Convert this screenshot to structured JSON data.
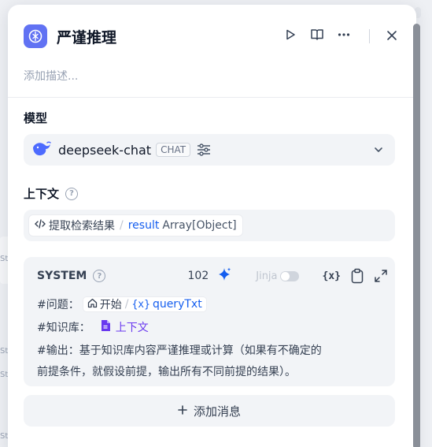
{
  "node": {
    "title": "严谨推理",
    "description_placeholder": "添加描述..."
  },
  "model": {
    "label": "模型",
    "name": "deepseek-chat",
    "mode_badge": "CHAT"
  },
  "context": {
    "label": "上下文",
    "chip": {
      "node_name": "提取检索结果",
      "variable": "result",
      "type": "Array[Object]"
    }
  },
  "system_prompt": {
    "role": "SYSTEM",
    "token_count": "102",
    "jinja_label": "Jinja",
    "jinja_enabled": false,
    "lines": {
      "question_prefix": "#问题：",
      "question_node": "开始",
      "question_var": "queryTxt",
      "kb_prefix": "#知识库：",
      "kb_ref": "上下文",
      "output_line1": "#输出：基于知识库内容严谨推理或计算（如果有不确定的",
      "output_line2": "前提条件，就假设前提，输出所有不同前提的结果）。"
    }
  },
  "add_message_label": "添加消息",
  "background_hint": "St",
  "colors": {
    "accent": "#6172f3",
    "variable_blue": "#155eef",
    "kb_purple": "#6938ef",
    "panel_fill": "#f2f4f7"
  },
  "icons": [
    "llm-node-icon",
    "play-icon",
    "book-open-icon",
    "more-icon",
    "close-icon",
    "deepseek-whale-icon",
    "sliders-icon",
    "chevron-down-icon",
    "help-icon",
    "code-icon",
    "sparkle-icon",
    "variable-icon",
    "clipboard-icon",
    "expand-icon",
    "home-icon",
    "document-icon",
    "plus-icon"
  ]
}
